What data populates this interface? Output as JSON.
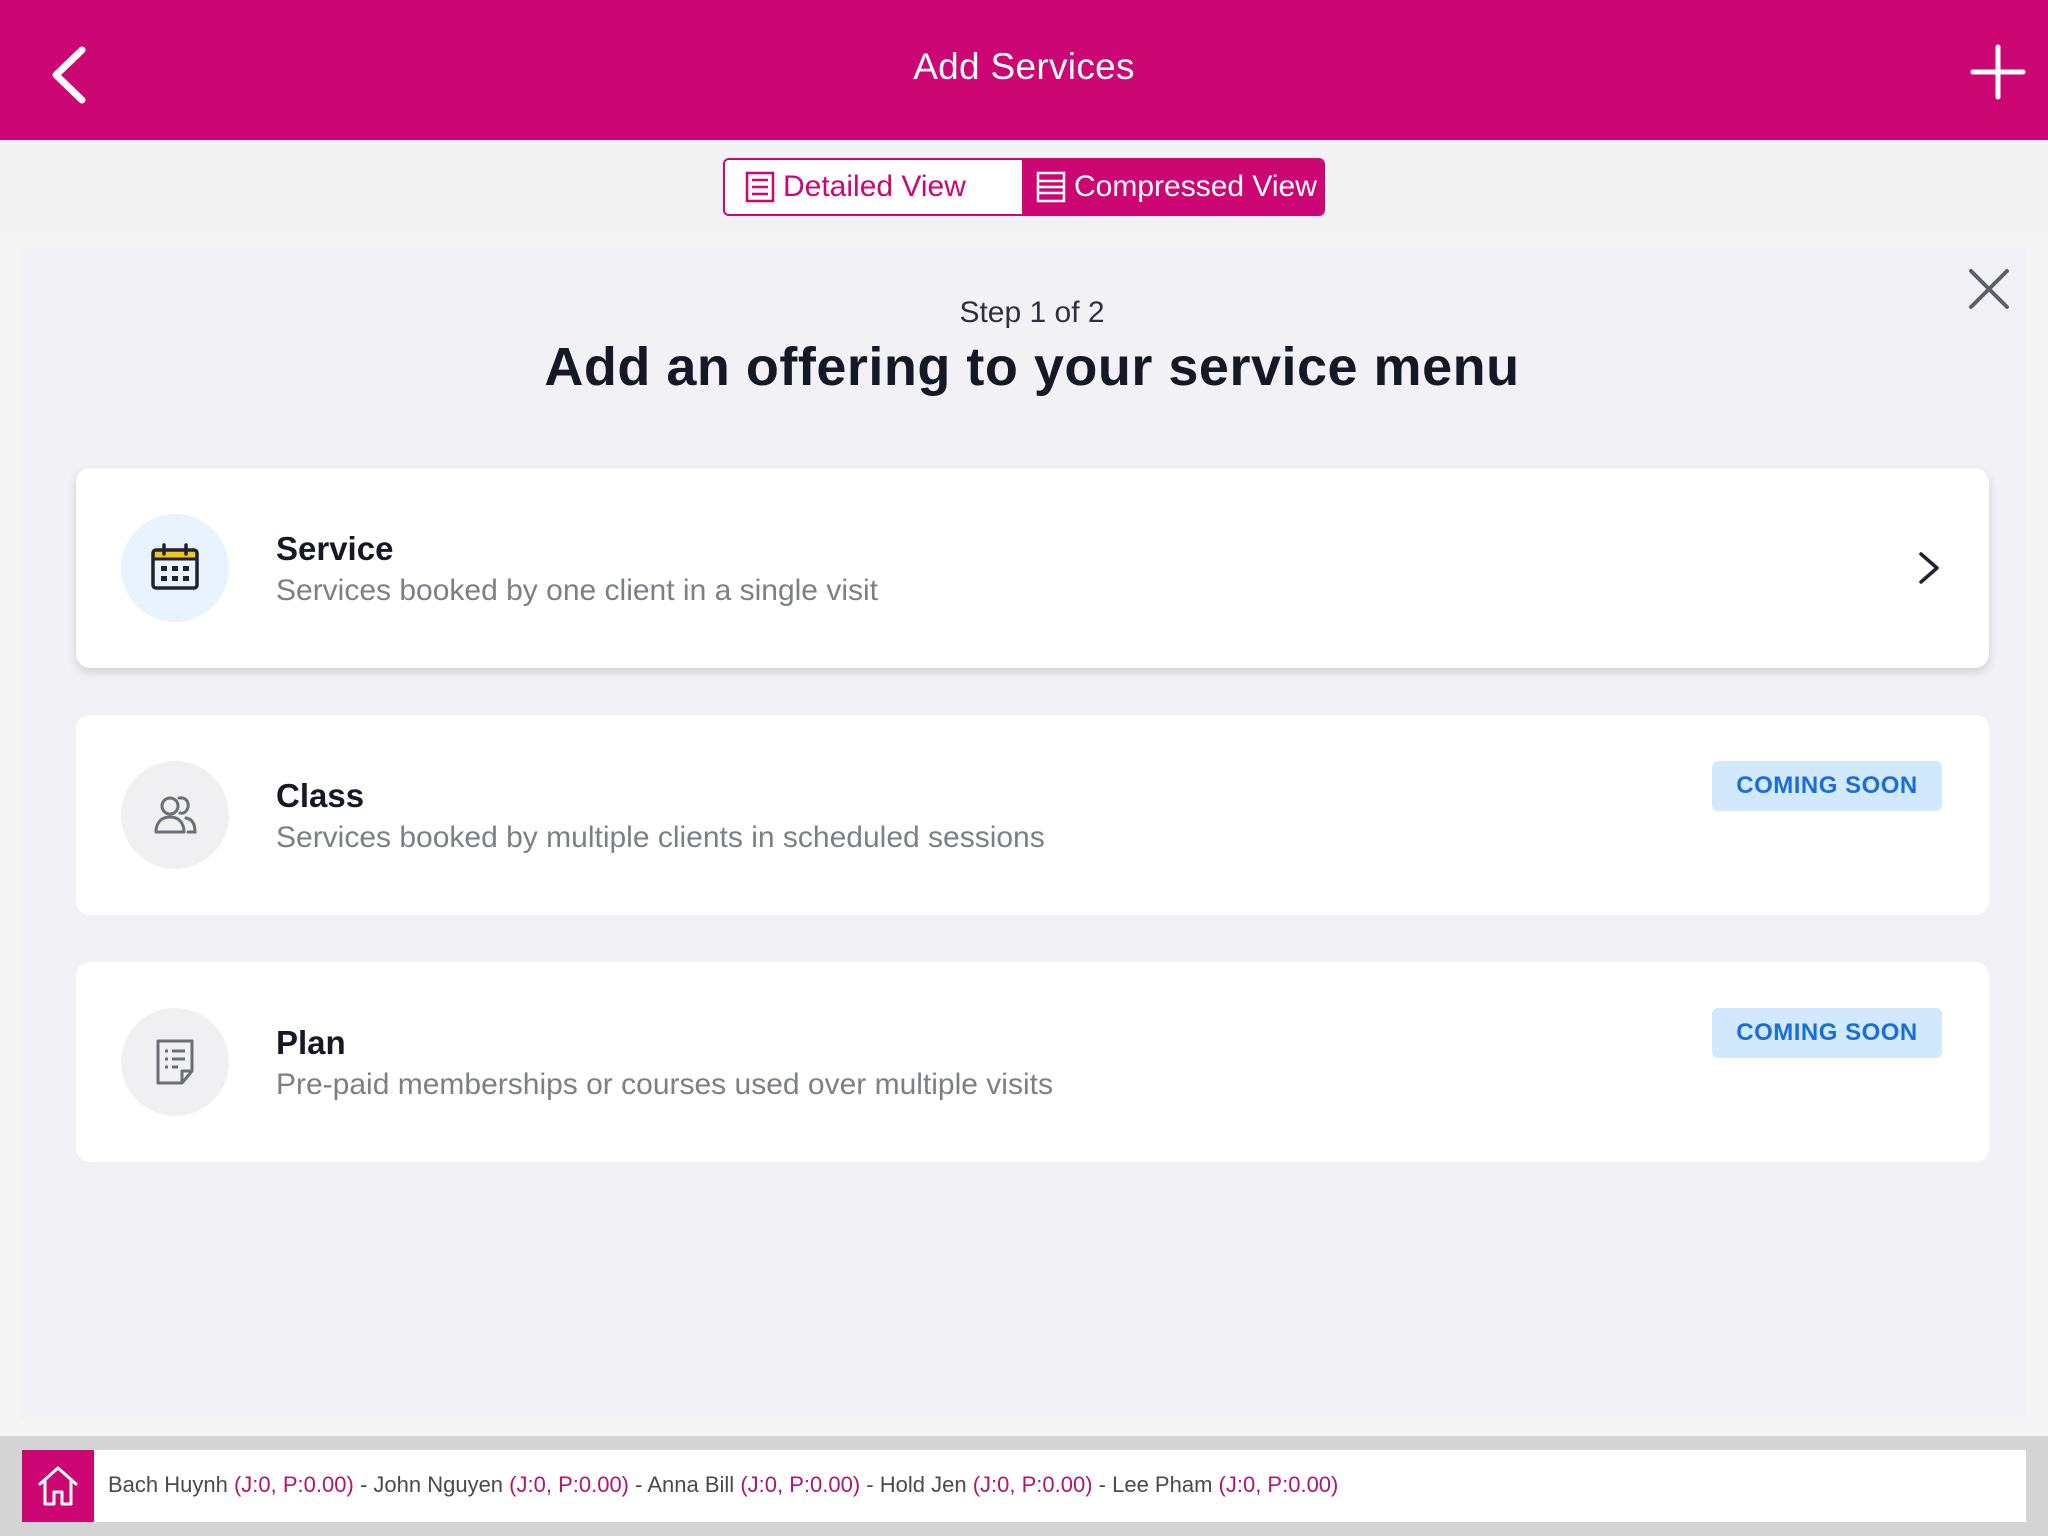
{
  "header": {
    "title": "Add Services",
    "back_icon": "chevron-left-icon",
    "add_icon": "plus-icon"
  },
  "view_toggle": {
    "detailed_label": "Detailed View",
    "compressed_label": "Compressed View",
    "selected": "Compressed View"
  },
  "modal": {
    "step": "Step 1 of 2",
    "title": "Add an offering to your service menu",
    "options": [
      {
        "title": "Service",
        "description": "Services booked by one client in a single visit",
        "icon": "calendar-icon",
        "badge": ""
      },
      {
        "title": "Class",
        "description": "Services booked by multiple clients in scheduled sessions",
        "icon": "users-icon",
        "badge": "COMING SOON"
      },
      {
        "title": "Plan",
        "description": "Pre-paid memberships or courses used over multiple visits",
        "icon": "document-icon",
        "badge": "COMING SOON"
      }
    ]
  },
  "footer": {
    "staff": [
      {
        "name": "Bach Huynh",
        "stat": "(J:0, P:0.00)"
      },
      {
        "name": "John Nguyen",
        "stat": "(J:0, P:0.00)"
      },
      {
        "name": "Anna Bill",
        "stat": "(J:0, P:0.00)"
      },
      {
        "name": "Hold Jen",
        "stat": "(J:0, P:0.00)"
      },
      {
        "name": "Lee Pham",
        "stat": "(J:0, P:0.00)"
      }
    ],
    "separator": " - "
  },
  "colors": {
    "brand": "#cc0673",
    "badge_bg": "#d2e8fd",
    "badge_text": "#1a6fd6"
  }
}
